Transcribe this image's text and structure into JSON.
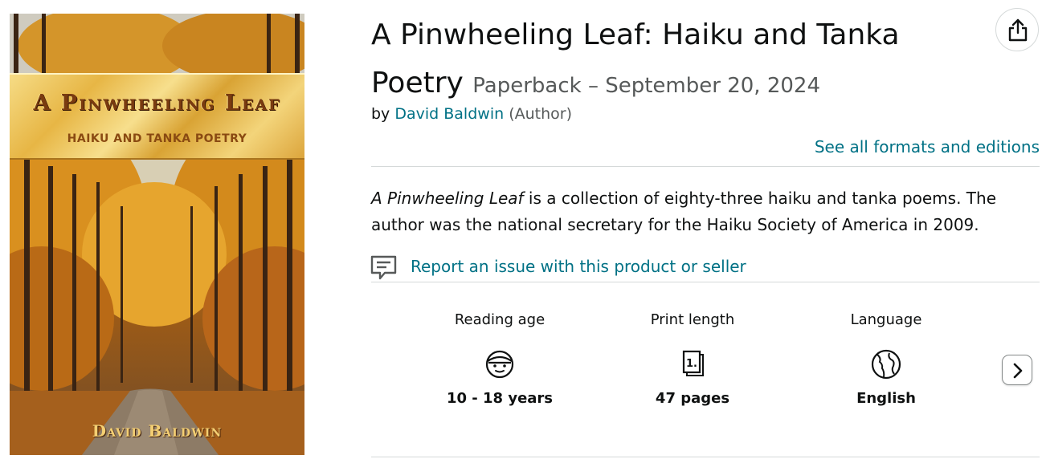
{
  "cover": {
    "title": "A Pinwheeling Leaf",
    "subtitle": "HAIKU AND TANKA POETRY",
    "author": "David Baldwin"
  },
  "product": {
    "title": "A Pinwheeling Leaf: Haiku and Tanka Poetry",
    "format": "Paperback – September 20, 2024",
    "by_prefix": "by",
    "author": "David Baldwin",
    "author_role": "(Author)",
    "formats_link": "See all formats and editions"
  },
  "description": {
    "italic_title": "A Pinwheeling Leaf",
    "text": " is a collection of eighty-three haiku and tanka poems. The author was the national secretary for the Haiku Society of America in 2009."
  },
  "report_link": "Report an issue with this product or seller",
  "attributes": [
    {
      "label": "Reading age",
      "icon": "child-face-icon",
      "value": "10 - 18 years"
    },
    {
      "label": "Print length",
      "icon": "pages-icon",
      "value": "47 pages"
    },
    {
      "label": "Language",
      "icon": "globe-icon",
      "value": "English"
    }
  ],
  "colors": {
    "link": "#007185",
    "text": "#0f1111",
    "secondary_text": "#565959",
    "divider": "#d5d9d9"
  }
}
